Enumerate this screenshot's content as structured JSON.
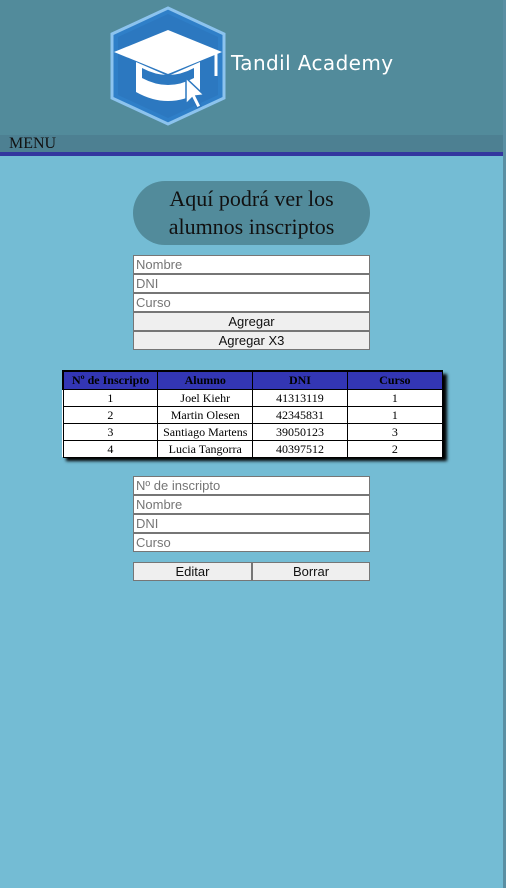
{
  "header": {
    "brand": "Tandil Academy",
    "logo_icon": "graduation-cap-cursor-icon",
    "colors": {
      "header_bg": "#528b9b",
      "page_bg": "#74bcd4",
      "accent_line": "#33369e",
      "logo_blue": "#2f7fc8"
    }
  },
  "menu": {
    "label": "MENU"
  },
  "title": {
    "line1": "Aquí podrá ver los",
    "line2": "alumnos inscriptos"
  },
  "add_form": {
    "nombre_placeholder": "Nombre",
    "dni_placeholder": "DNI",
    "curso_placeholder": "Curso",
    "agregar_label": "Agregar",
    "agregar_x3_label": "Agregar X3"
  },
  "table": {
    "headers": [
      "Nº de Inscripto",
      "Alumno",
      "DNI",
      "Curso"
    ],
    "rows": [
      {
        "num": "1",
        "alumno": "Joel Kiehr",
        "dni": "41313119",
        "curso": "1"
      },
      {
        "num": "2",
        "alumno": "Martin Olesen",
        "dni": "42345831",
        "curso": "1"
      },
      {
        "num": "3",
        "alumno": "Santiago Martens",
        "dni": "39050123",
        "curso": "3"
      },
      {
        "num": "4",
        "alumno": "Lucia Tangorra",
        "dni": "40397512",
        "curso": "2"
      }
    ]
  },
  "edit_form": {
    "inscripto_placeholder": "Nº de inscripto",
    "nombre_placeholder": "Nombre",
    "dni_placeholder": "DNI",
    "curso_placeholder": "Curso",
    "editar_label": "Editar",
    "borrar_label": "Borrar"
  }
}
